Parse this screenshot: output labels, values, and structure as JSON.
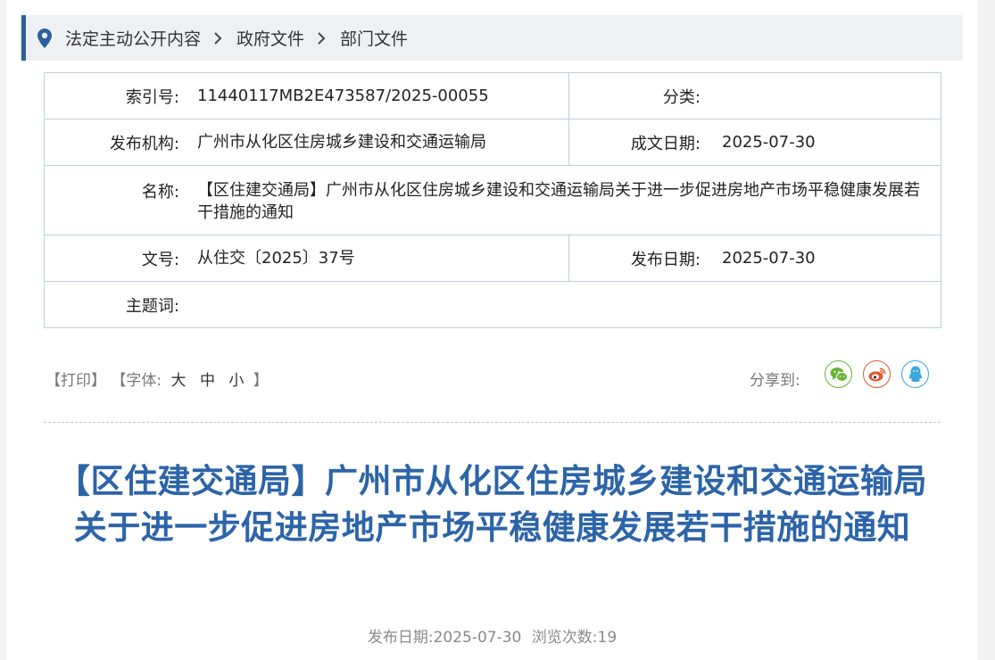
{
  "breadcrumb": {
    "items": [
      "法定主动公开内容",
      "政府文件",
      "部门文件"
    ]
  },
  "meta": {
    "index_label": "索引号:",
    "index_value": "11440117MB2E473587/2025-00055",
    "category_label": "分类:",
    "category_value": "",
    "publisher_label": "发布机构:",
    "publisher_value": "广州市从化区住房城乡建设和交通运输局",
    "written_date_label": "成文日期:",
    "written_date_value": "2025-07-30",
    "name_label": "名称:",
    "name_value": "【区住建交通局】广州市从化区住房城乡建设和交通运输局关于进一步促进房地产市场平稳健康发展若干措施的通知",
    "doc_no_label": "文号:",
    "doc_no_value": "从住交〔2025〕37号",
    "publish_date_label": "发布日期:",
    "publish_date_value": "2025-07-30",
    "keywords_label": "主题词:",
    "keywords_value": ""
  },
  "toolbar": {
    "print": "【打印】",
    "font_open": "【字体:",
    "font_large": "大",
    "font_medium": "中",
    "font_small": "小",
    "font_close": "】",
    "share_label": "分享到:"
  },
  "icons": {
    "location": "map-pin-icon",
    "separator": "chevron-right-icon",
    "wechat": "wechat-icon",
    "weibo": "weibo-icon",
    "qq": "qq-icon"
  },
  "colors": {
    "accent": "#2c5f9e",
    "title": "#2c64a8",
    "wechat": "#67b436",
    "weibo": "#e0582c",
    "qq": "#3aa8dd"
  },
  "article": {
    "title": "【区住建交通局】广州市从化区住房城乡建设和交通运输局关于进一步促进房地产市场平稳健康发展若干措施的通知",
    "publish_label": "发布日期:",
    "publish_date": "2025-07-30",
    "views_label": "浏览次数:",
    "views": "19"
  }
}
